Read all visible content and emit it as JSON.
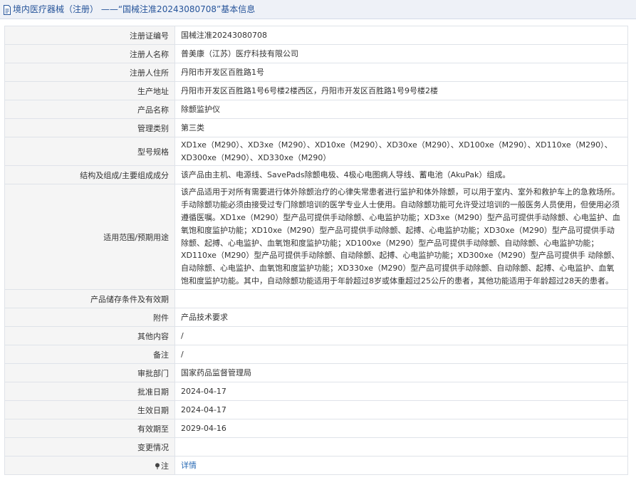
{
  "header": {
    "category": "境内医疗器械（注册）",
    "separator": "——",
    "title": "“国械注准20243080708”基本信息"
  },
  "rows": [
    {
      "label": "注册证编号",
      "value": "国械注准20243080708"
    },
    {
      "label": "注册人名称",
      "value": "普美康（江苏）医疗科技有限公司"
    },
    {
      "label": "注册人住所",
      "value": "丹阳市开发区百胜路1号"
    },
    {
      "label": "生产地址",
      "value": "丹阳市开发区百胜路1号6号楼2楼西区，丹阳市开发区百胜路1号9号楼2楼"
    },
    {
      "label": "产品名称",
      "value": "除颤监护仪"
    },
    {
      "label": "管理类别",
      "value": "第三类"
    },
    {
      "label": "型号规格",
      "value": "XD1xe（M290）、XD3xe（M290）、XD10xe（M290）、XD30xe（M290）、XD100xe（M290）、XD110xe（M290）、XD300xe（M290）、XD330xe（M290）"
    },
    {
      "label": "结构及组成/主要组成成分",
      "value": "该产品由主机、电源线、SavePads除颤电极、4极心电图病人导线、蓄电池（AkuPak）组成。"
    },
    {
      "label": "适用范围/预期用途",
      "value": "该产品适用于对所有需要进行体外除颤治疗的心律失常患者进行监护和体外除颤，可以用于室内、室外和救护车上的急救场所。手动除颤功能必须由接受过专门除颤培训的医学专业人士使用。自动除颤功能可允许受过培训的一般医务人员使用，但使用必须遵循医嘱。XD1xe（M290）型产品可提供手动除颤、心电监护功能；XD3xe（M290）型产品可提供手动除颤、心电监护、血氧饱和度监护功能；XD10xe（M290）型产品可提供手动除颤、起搏、心电监护功能；XD30xe（M290）型产品可提供手动除颤、起搏、心电监护、血氧饱和度监护功能；XD100xe（M290）型产品可提供手动除颤、自动除颤、心电监护功能；XD110xe（M290）型产品可提供手动除颤、自动除颤、起搏、心电监护功能；XD300xe（M290）型产品可提供手 动除颤、自动除颤、心电监护、血氧饱和度监护功能；XD330xe（M290）型产品可提供手动除颤、自动除颤、起搏、心电监护、血氧饱和度监护功能。其中，自动除颤功能适用于年龄超过8岁或体重超过25公斤的患者，其他功能适用于年龄超过28天的患者。"
    },
    {
      "label": "产品储存条件及有效期",
      "value": ""
    },
    {
      "label": "附件",
      "value": "产品技术要求"
    },
    {
      "label": "其他内容",
      "value": "/"
    },
    {
      "label": "备注",
      "value": "/"
    },
    {
      "label": "审批部门",
      "value": "国家药品监督管理局"
    },
    {
      "label": "批准日期",
      "value": "2024-04-17"
    },
    {
      "label": "生效日期",
      "value": "2024-04-17"
    },
    {
      "label": "有效期至",
      "value": "2029-04-16"
    },
    {
      "label": "变更情况",
      "value": ""
    },
    {
      "label": "注",
      "value": "详情"
    }
  ],
  "colors": {
    "header_bg": "#eef1f7",
    "header_text": "#26549a",
    "label_bg": "#f5f5f5",
    "border": "#dfe3e9",
    "link": "#2a6bb5"
  },
  "icons": {
    "header": "document-icon",
    "note": "pin-icon"
  }
}
